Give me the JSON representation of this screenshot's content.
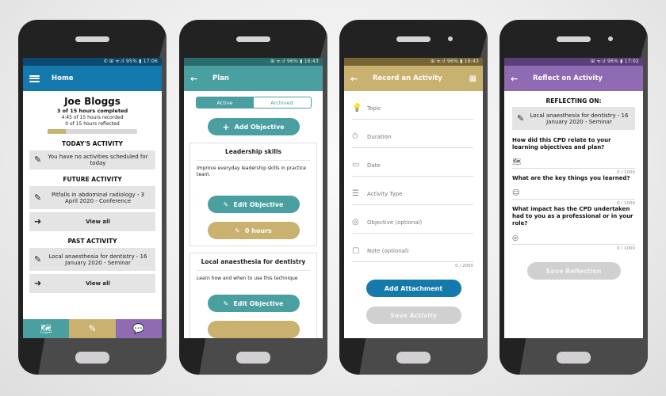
{
  "phones": [
    {
      "status": {
        "icons": "✆ ⊞ ᯤ.ıl",
        "battery": "95%",
        "time": "17:06"
      },
      "appbar": {
        "title": "Home",
        "leading_icon": "menu-icon"
      },
      "user": {
        "name": "Joe Bloggs",
        "completed": "3 of 15 hours completed",
        "recorded": "4:45 of 15 hours recorded",
        "reflected": "0 of 15 hours reflected",
        "progress_fraction": 0.2
      },
      "today": {
        "heading": "TODAY'S ACTIVITY",
        "text": "You have no activities scheduled for today"
      },
      "future": {
        "heading": "FUTURE ACTIVITY",
        "text": "Pitfalls in abdominal radiology - 3 April 2020 - Conference",
        "view_all": "View all"
      },
      "past": {
        "heading": "PAST ACTIVITY",
        "text": "Local anaesthesia for dentistry - 16 January 2020 - Seminar",
        "view_all": "View all"
      },
      "bottom_nav": [
        {
          "icon": "map-icon",
          "color": "#4aa0a0"
        },
        {
          "icon": "pencil-icon",
          "color": "#c9b170"
        },
        {
          "icon": "chat-icon",
          "color": "#8e6bb3"
        }
      ]
    },
    {
      "status": {
        "icons": "⊞ ᯤ.ıl",
        "battery": "96%",
        "time": "16:43"
      },
      "appbar": {
        "title": "Plan",
        "leading_icon": "back-arrow-icon"
      },
      "tabs": [
        {
          "label": "Active",
          "selected": true
        },
        {
          "label": "Archived",
          "selected": false
        }
      ],
      "add_objective": "Add Objective",
      "objectives": [
        {
          "title": "Leadership skills",
          "description": "Improve everyday leadership skills in practice team.",
          "edit_label": "Edit Objective",
          "hours_label": "0 hours"
        },
        {
          "title": "Local anaesthesia for dentistry",
          "description": "Learn how and when to use this technique",
          "edit_label": "Edit Objective"
        }
      ]
    },
    {
      "status": {
        "icons": "⊞ ᯤ.ıl",
        "battery": "96%",
        "time": "16:43"
      },
      "appbar": {
        "title": "Record an Activity",
        "leading_icon": "back-arrow-icon",
        "trailing_icon": "qr-code-icon"
      },
      "fields": [
        {
          "placeholder": "Topic",
          "icon": "lightbulb-icon"
        },
        {
          "placeholder": "Duration",
          "icon": "stopwatch-icon"
        },
        {
          "placeholder": "Date",
          "icon": "calendar-icon"
        },
        {
          "placeholder": "Activity Type",
          "icon": "list-icon"
        },
        {
          "placeholder": "Objective (optional)",
          "icon": "target-icon"
        },
        {
          "placeholder": "Note (optional)",
          "icon": "note-icon"
        }
      ],
      "note_counter": "0 / 2000",
      "add_attachment": "Add Attachment",
      "save_activity": "Save Activity"
    },
    {
      "status": {
        "icons": "⊞ ᯤ.ıl",
        "battery": "96%",
        "time": "17:02"
      },
      "appbar": {
        "title": "Reflect on Activity",
        "leading_icon": "back-arrow-icon"
      },
      "reflecting_heading": "REFLECTING ON:",
      "reflecting_item": "Local anaesthesia for dentistry - 16 January 2020 - Seminar",
      "questions": [
        {
          "text": "How did this CPD relate to your learning objectives and plan?",
          "icon": "map-icon",
          "counter": "0 / 1000"
        },
        {
          "text": "What are the key things you learned?",
          "icon": "head-icon",
          "counter": "0 / 1000"
        },
        {
          "text": "What impact has the CPD undertaken had to you as a professional or in your role?",
          "icon": "target-icon",
          "counter": "0 / 1000"
        }
      ],
      "save_reflection": "Save Reflection"
    }
  ]
}
